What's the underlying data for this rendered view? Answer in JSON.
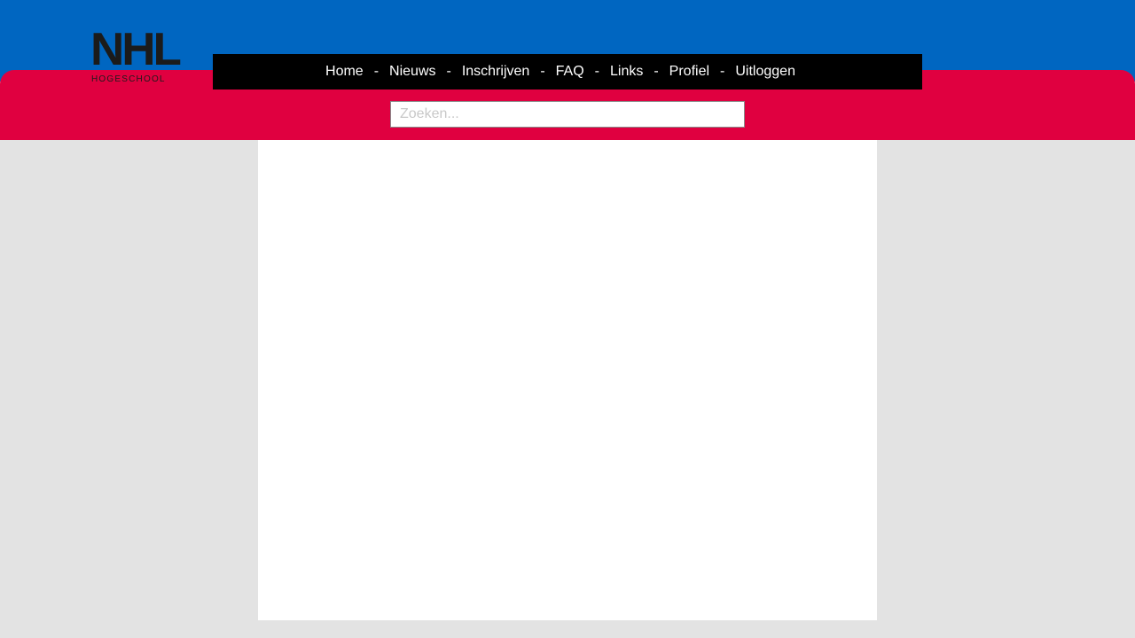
{
  "brand": {
    "logo_main": "NHL",
    "logo_sub": "HOGESCHOOL"
  },
  "nav": {
    "separator": "-",
    "items": [
      {
        "label": "Home"
      },
      {
        "label": "Nieuws"
      },
      {
        "label": "Inschrijven"
      },
      {
        "label": "FAQ"
      },
      {
        "label": "Links"
      },
      {
        "label": "Profiel"
      },
      {
        "label": "Uitloggen"
      }
    ]
  },
  "search": {
    "placeholder": "Zoeken...",
    "value": ""
  },
  "colors": {
    "header_blue": "#0066c1",
    "header_red": "#e00040",
    "navbar": "#000000",
    "page_background": "#e3e3e3",
    "content_background": "#ffffff"
  }
}
